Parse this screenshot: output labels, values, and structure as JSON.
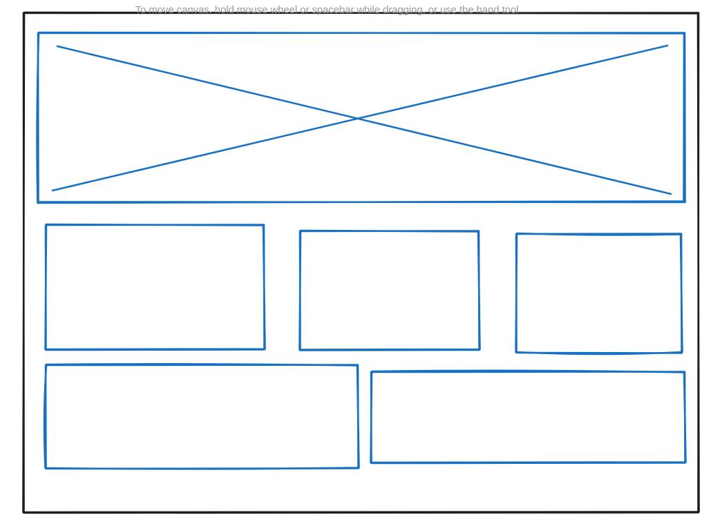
{
  "canvas": {
    "hint_text": "To move canvas, hold mouse wheel or spacebar while dragging, or use the hand tool"
  },
  "colors": {
    "background": "#ffffff",
    "frame_stroke": "#1e1e1e",
    "shape_stroke": "#1971c2",
    "hint_text": "#9a9a9a"
  },
  "shapes": [
    {
      "kind": "frame",
      "name": "wireframe-page-frame"
    },
    {
      "kind": "image-placeholder",
      "name": "hero-image-placeholder"
    },
    {
      "kind": "rectangle",
      "name": "content-box-row2-left"
    },
    {
      "kind": "rectangle",
      "name": "content-box-row2-middle"
    },
    {
      "kind": "rectangle",
      "name": "content-box-row2-right"
    },
    {
      "kind": "rectangle",
      "name": "content-box-row3-left"
    },
    {
      "kind": "rectangle",
      "name": "content-box-row3-right"
    }
  ]
}
